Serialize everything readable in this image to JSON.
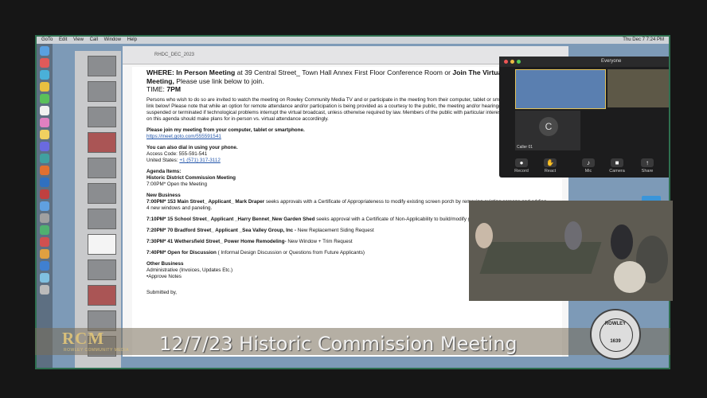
{
  "menubar": {
    "items": [
      "GoTo",
      "Edit",
      "View",
      "Call",
      "Window",
      "Help"
    ],
    "time": "Thu Dec 7  7:24 PM"
  },
  "document": {
    "title": "RHDC_DEC_2023",
    "where_label": "WHERE:",
    "where_inperson": "In Person Meeting",
    "where_address": "at 39 Central Street_ Town Hall Annex First Floor Conference Room",
    "or_label": "or",
    "where_virtual": "Join The Virtual GoTo Meeting,",
    "where_virtual_rest": "Please use link below to join.",
    "time_label": "TIME:",
    "time_value": "7PM",
    "public_notice": "Persons who wish to do so are invited to watch the meeting on Rowley Community Media TV and or participate in the meeting from their computer, tablet or smartphone by using the link below! Please note that while an option for remote attendance and/or participation is being provided as a courtesy to the public, the meeting and/or hearing(s) will not be suspended or terminated if technological problems interrupt the virtual broadcast, unless otherwise required by law. Members of the public with particular interest in any specific item on this agenda should make plans for in-person vs. virtual attendance accordingly.",
    "join_heading": "Please join my meeting from your computer, tablet or smartphone.",
    "join_link": "https://meet.goto.com/555591541",
    "dial_heading": "You can also dial in using your phone.",
    "access_code": "Access Code: 555-591-541",
    "us_label": "United States:",
    "us_phone": "+1 (571) 317-3112",
    "agenda_heading": "Agenda Items:",
    "commission_heading": "Historic District Commission Meeting",
    "open_meeting": "7:00PM* Open the Meeting",
    "new_business": "New Business",
    "item1_head": "7:00PM* 153 Main Street_ Applicant_ Mark Draper",
    "item1_text": "seeks approvals with a Certificate of Appropriateness to modify existing screen porch by removing existing screens and adding 4 new windows and paneling.",
    "item2_head": "7:10PM* 15 School Street_ Applicant _Harry Bennet_New Garden Shed",
    "item2_text": "seeks approval with a Certificate of Non-Applicability to build/modify garden shed in yard.",
    "item3_head": "7:20PM* 70 Bradford Street_ Applicant _Sea Valley Group, Inc -",
    "item3_text": "New Replacement Siding Request",
    "item4_head": "7:30PM* 41 Wethersfield Street_ Power Home Remodeling-",
    "item4_text": "New Window + Trim Request",
    "item5_head": "7:40PM* Open for Discussion",
    "item5_text": "( Informal Design Discussion or Questions from Future Applicants)",
    "other_business": "Other Business",
    "admin": "Administrative (Invoices, Updates Etc.)",
    "approve": "•Approve Notes",
    "submitted": "Submitted by,"
  },
  "zoom": {
    "view_label": "Everyone",
    "caller": "Caller 01",
    "avatar_letter": "C",
    "buttons": [
      {
        "label": "Record"
      },
      {
        "label": "React"
      },
      {
        "label": "Mic"
      },
      {
        "label": "Camera"
      },
      {
        "label": "Share"
      }
    ]
  },
  "overlay": {
    "logo": "RCM",
    "logo_sub": "ROWLEY COMMUNITY MEDIA",
    "caption": "12/7/23 Historic Commission Meeting",
    "seal_top": "ROWLEY",
    "seal_mid": "1639"
  }
}
